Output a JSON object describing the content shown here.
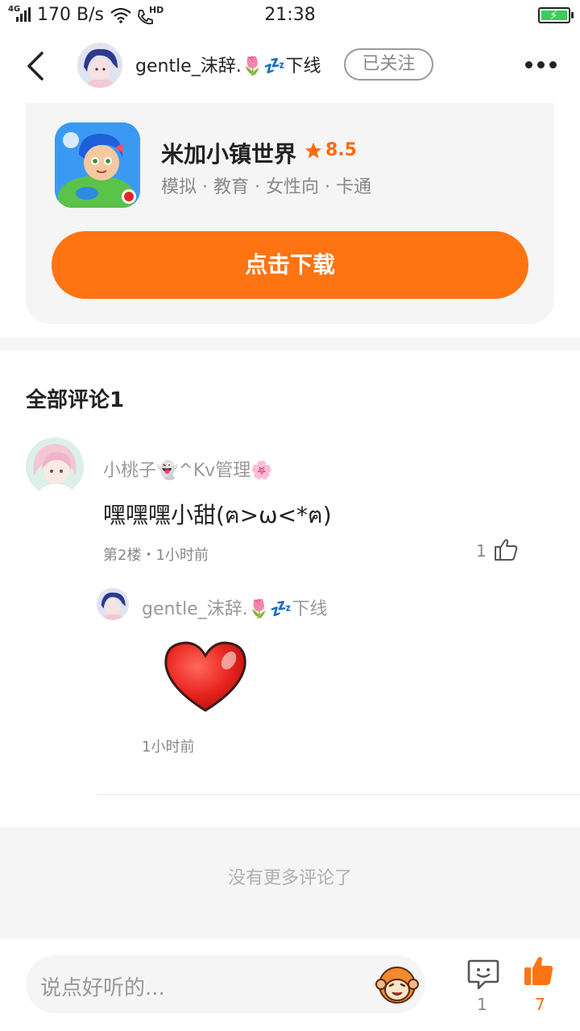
{
  "status_bar": {
    "network_tag": "4G",
    "speed": "170 B/s",
    "call_tag": "HD",
    "time": "21:38"
  },
  "header": {
    "username": "gentle_沫辞.🌷💤下线",
    "follow_label": "已关注"
  },
  "app": {
    "name": "米加小镇世界",
    "rating": "8.5",
    "tags": "模拟 · 教育 · 女性向 · 卡通",
    "download_label": "点击下载"
  },
  "comments": {
    "title": "全部评论1",
    "items": [
      {
        "user": "小桃子👻^Kv管理🌸",
        "text": "嘿嘿嘿小甜(ฅ>ω<*ฅ)",
        "meta": "第2楼・1小时前",
        "likes": "1",
        "reply": {
          "user": "gentle_沫辞.🌷💤下线",
          "time": "1小时前"
        }
      }
    ],
    "no_more": "没有更多评论了"
  },
  "bottom_bar": {
    "input_placeholder": "说点好听的...",
    "comment_count": "1",
    "like_count": "7"
  },
  "colors": {
    "accent": "#ff7412",
    "muted_text": "#888888",
    "card_bg": "#f5f5f5"
  }
}
